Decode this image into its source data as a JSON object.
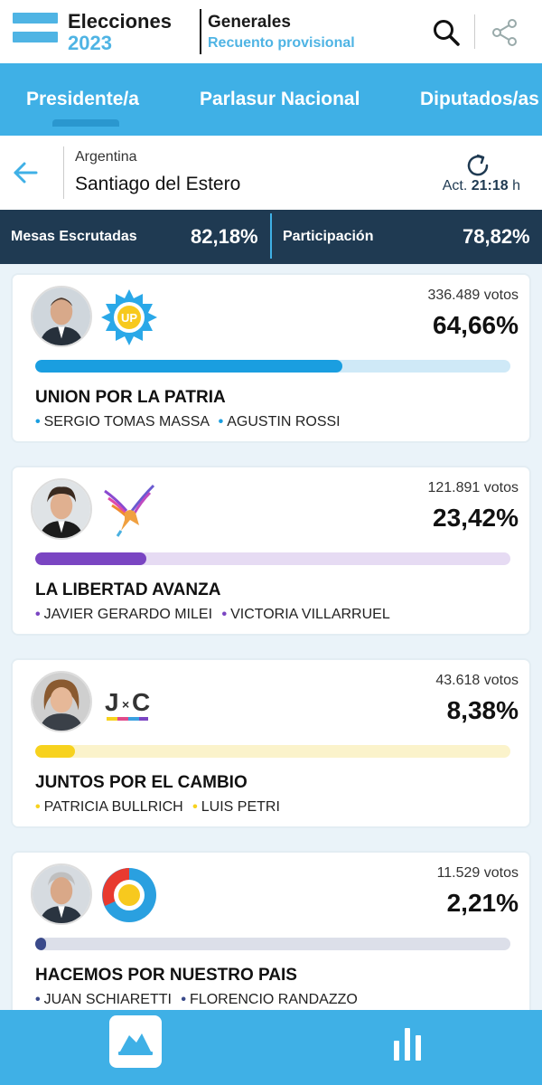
{
  "header": {
    "brand_line1": "Elecciones",
    "brand_line2": "2023",
    "title": "Generales",
    "subtitle": "Recuento provisional",
    "icons": [
      "search-icon",
      "share-icon"
    ]
  },
  "tabs": [
    {
      "label": "Presidente/a",
      "active": true
    },
    {
      "label": "Parlasur Nacional",
      "active": false
    },
    {
      "label": "Diputados/as",
      "active": false
    }
  ],
  "location": {
    "country": "Argentina",
    "province": "Santiago del Estero",
    "updated_label": "Act.",
    "updated_time": "21:18",
    "updated_unit": "h"
  },
  "stats": {
    "mesas_label": "Mesas Escrutadas",
    "mesas_value": "82,18%",
    "participacion_label": "Participación",
    "participacion_value": "78,82%"
  },
  "results": [
    {
      "votes": "336.489 votos",
      "percent": "64,66%",
      "share": 64.66,
      "party": "UNION POR LA PATRIA",
      "candidate1": "SERGIO TOMAS MASSA",
      "candidate2": "AGUSTIN ROSSI",
      "color": "#1a9ee0",
      "track_color": "#cfe9f7",
      "logo_text": "UP"
    },
    {
      "votes": "121.891 votos",
      "percent": "23,42%",
      "share": 23.42,
      "party": "LA LIBERTAD AVANZA",
      "candidate1": "JAVIER GERARDO MILEI",
      "candidate2": "VICTORIA VILLARRUEL",
      "color": "#7a45c2",
      "track_color": "#e6dbf3"
    },
    {
      "votes": "43.618 votos",
      "percent": "8,38%",
      "share": 8.38,
      "party": "JUNTOS POR EL CAMBIO",
      "candidate1": "PATRICIA BULLRICH",
      "candidate2": "LUIS PETRI",
      "color": "#f7d21e",
      "track_color": "#fbf3cb",
      "logo_text_a": "J",
      "logo_text_b": "×",
      "logo_text_c": "C"
    },
    {
      "votes": "11.529 votos",
      "percent": "2,21%",
      "share": 2.21,
      "party": "HACEMOS POR NUESTRO PAIS",
      "candidate1": "JUAN SCHIARETTI",
      "candidate2": "FLORENCIO RANDAZZO",
      "color": "#3a4a8a",
      "track_color": "#dcdfe9"
    }
  ],
  "bottom_nav": [
    "home-icon",
    "bar-chart-icon"
  ]
}
